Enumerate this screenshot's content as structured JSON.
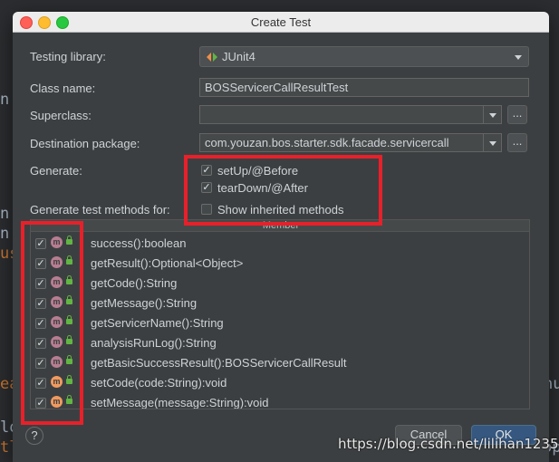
{
  "window": {
    "title": "Create Test"
  },
  "background_code": [
    "n",
    "n",
    "n",
    "us",
    "ea",
    "lo",
    "tl",
    "nu",
    "op"
  ],
  "form": {
    "testing_library_label": "Testing library:",
    "testing_library_value": "JUnit4",
    "class_name_label": "Class name:",
    "class_name_value": "BOSServicerCallResultTest",
    "superclass_label": "Superclass:",
    "superclass_value": "",
    "destination_label": "Destination package:",
    "destination_value": "com.youzan.bos.starter.sdk.facade.servicercall",
    "browse_label": "...",
    "generate_label": "Generate:",
    "generate_options": [
      {
        "label": "setUp/@Before",
        "checked": true
      },
      {
        "label": "tearDown/@After",
        "checked": true
      },
      {
        "label": "Show inherited methods",
        "checked": false
      }
    ],
    "methods_label": "Generate test methods for:"
  },
  "table": {
    "column_header": "Member",
    "rows": [
      {
        "name": "success():boolean",
        "checked": true
      },
      {
        "name": "getResult():Optional<Object>",
        "checked": true
      },
      {
        "name": "getCode():String",
        "checked": true
      },
      {
        "name": "getMessage():String",
        "checked": true
      },
      {
        "name": "getServicerName():String",
        "checked": true
      },
      {
        "name": "analysisRunLog():String",
        "checked": true
      },
      {
        "name": "getBasicSuccessResult():BOSServicerCallResult",
        "checked": true
      },
      {
        "name": "setCode(code:String):void",
        "checked": true
      },
      {
        "name": "setMessage(message:String):void",
        "checked": true
      }
    ],
    "method_icon_letter": "m"
  },
  "buttons": {
    "help": "?",
    "cancel": "Cancel",
    "ok": "OK"
  },
  "watermark": "https://blog.csdn.net/lilihan12358",
  "colors": {
    "highlight_box": "#e8202a",
    "ok_button": "#365880",
    "dialog_bg": "#3c3f41"
  }
}
